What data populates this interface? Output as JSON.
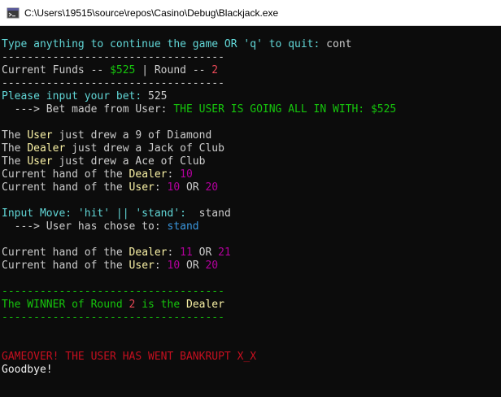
{
  "window": {
    "title": "C:\\Users\\19515\\source\\repos\\Casino\\Debug\\Blackjack.exe"
  },
  "console": {
    "prompt_continue": "Type anything to continue the game OR 'q' to quit: ",
    "input_continue": "cont",
    "separator": "-----------------------------------",
    "funds_label": "Current Funds -- ",
    "funds_value": "$525",
    "round_sep": " | Round -- ",
    "round_value": "2",
    "bet_prompt": "Please input your bet: ",
    "bet_value": "525",
    "bet_arrow": "  ---> Bet made from User: ",
    "bet_message": "THE USER IS GOING ALL IN WITH: $525",
    "draw1_pre": "The ",
    "draw1_who": "User",
    "draw1_post": " just drew a 9 of Diamond",
    "draw2_pre": "The ",
    "draw2_who": "Dealer",
    "draw2_post": " just drew a Jack of Club",
    "draw3_pre": "The ",
    "draw3_who": "User",
    "draw3_post": " just drew a Ace of Club",
    "hand_pre": "Current hand of the ",
    "dealer": "Dealer",
    "user": "User",
    "colon": ": ",
    "or": " OR ",
    "dealer_hand1": "10",
    "user_hand1_a": "10",
    "user_hand1_b": "20",
    "move_prompt": "Input Move: 'hit' || 'stand':  ",
    "move_input": "stand",
    "move_arrow": "  ---> User has chose to: ",
    "move_choice": "stand",
    "dealer_hand2_a": "11",
    "dealer_hand2_b": "21",
    "user_hand2_a": "10",
    "user_hand2_b": "20",
    "winner_pre": "The WINNER of Round ",
    "winner_round": "2",
    "winner_mid": " is the ",
    "winner_who": "Dealer",
    "gameover": "GAMEOVER! THE USER HAS WENT BANKRUPT X_X",
    "goodbye": "Goodbye!"
  },
  "colors": {
    "background": "#0c0c0c",
    "text": "#cccccc",
    "cyan": "#61d6d6",
    "green": "#16c60c",
    "yellow": "#f9f1a5",
    "red": "#e74856",
    "dark_red": "#c50f1f",
    "magenta": "#b4009e",
    "blue": "#3b78ff"
  }
}
